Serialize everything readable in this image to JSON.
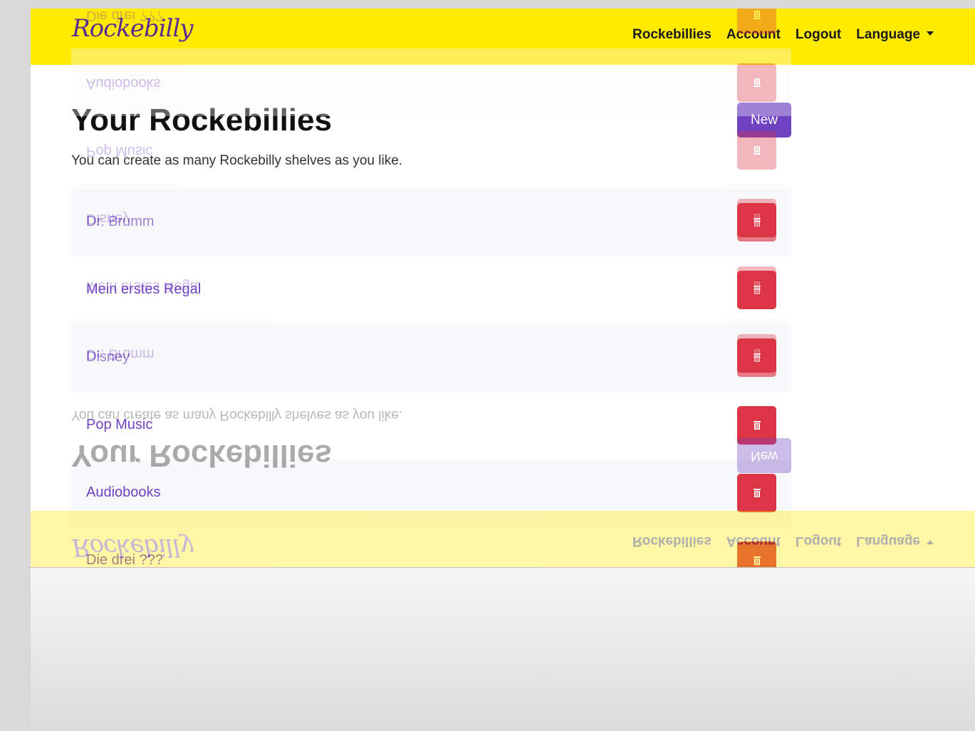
{
  "brand": {
    "name": "Rockebilly"
  },
  "nav": {
    "rockebillies": "Rockebillies",
    "account": "Account",
    "logout": "Logout",
    "language": "Language"
  },
  "page": {
    "title": "Your Rockebillies",
    "new_button": "New",
    "subtitle": "You can create as many Rockebilly shelves as you like."
  },
  "shelves": [
    {
      "name": "Dr. Brumm"
    },
    {
      "name": "Mein erstes Regal"
    },
    {
      "name": "Disney"
    },
    {
      "name": "Pop Music"
    },
    {
      "name": "Audiobooks"
    },
    {
      "name": "Die drei ???"
    }
  ],
  "icons": {
    "delete": "trash-icon",
    "dropdown": "caret-down-icon"
  },
  "colors": {
    "navbar": "#ffea00",
    "accent": "#6f42c1",
    "danger": "#dc3545",
    "brand": "#5a2c91"
  }
}
